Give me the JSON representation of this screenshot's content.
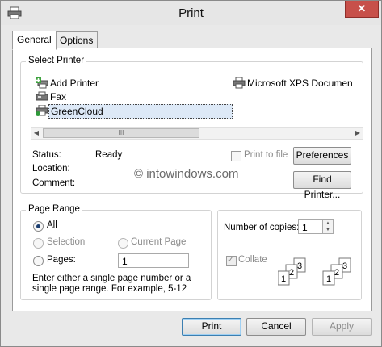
{
  "window": {
    "title": "Print"
  },
  "tabs": [
    {
      "label": "General"
    },
    {
      "label": "Options"
    }
  ],
  "select_printer": {
    "group_label": "Select Printer",
    "printers": [
      {
        "label": "Add Printer",
        "icon": "add-printer-icon"
      },
      {
        "label": "Microsoft XPS Documen",
        "icon": "printer-icon"
      },
      {
        "label": "Fax",
        "icon": "fax-icon"
      },
      {
        "label": "GreenCloud",
        "icon": "printer-icon",
        "selected": true
      }
    ],
    "status_label": "Status:",
    "status_value": "Ready",
    "location_label": "Location:",
    "comment_label": "Comment:",
    "print_to_file_label": "Print to file",
    "preferences_label": "Preferences",
    "find_printer_label": "Find Printer..."
  },
  "watermark": "© intowindows.com",
  "page_range": {
    "group_label": "Page Range",
    "all_label": "All",
    "selection_label": "Selection",
    "current_page_label": "Current Page",
    "pages_label": "Pages:",
    "pages_value": "1",
    "hint": "Enter either a single page number or a single page range.  For example, 5-12"
  },
  "copies": {
    "number_label": "Number of copies:",
    "number_value": "1",
    "collate_label": "Collate",
    "collate_icon_digits": [
      "1",
      "2",
      "3"
    ]
  },
  "buttons": {
    "print": "Print",
    "cancel": "Cancel",
    "apply": "Apply"
  },
  "colors": {
    "close_button": "#c7504a",
    "selection_bg": "#dde9f7",
    "default_border": "#3c7fb1"
  }
}
